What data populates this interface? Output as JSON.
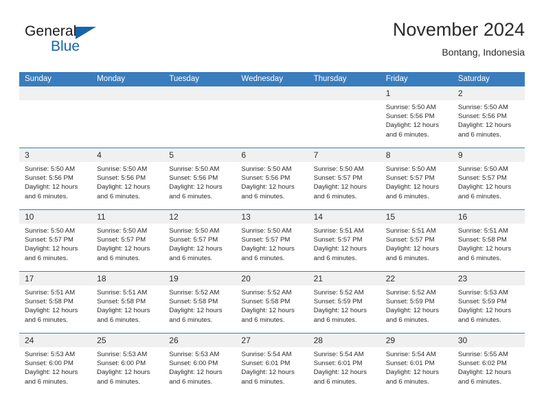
{
  "brand": {
    "name_part1": "General",
    "name_part2": "Blue",
    "triangle_color": "#1565a8"
  },
  "header": {
    "title": "November 2024",
    "subtitle": "Bontang, Indonesia"
  },
  "theme": {
    "header_blue": "#3a7dbe",
    "daynum_gray": "#f0f0f0",
    "text": "#2b2b2b"
  },
  "weekdays": [
    "Sunday",
    "Monday",
    "Tuesday",
    "Wednesday",
    "Thursday",
    "Friday",
    "Saturday"
  ],
  "labels": {
    "sunrise_prefix": "Sunrise:",
    "sunset_prefix": "Sunset:",
    "daylight_prefix": "Daylight:"
  },
  "weeks": [
    [
      {
        "day": "",
        "blank": true
      },
      {
        "day": "",
        "blank": true
      },
      {
        "day": "",
        "blank": true
      },
      {
        "day": "",
        "blank": true
      },
      {
        "day": "",
        "blank": true
      },
      {
        "day": "1",
        "sunrise": "Sunrise: 5:50 AM",
        "sunset": "Sunset: 5:56 PM",
        "daylight1": "Daylight: 12 hours",
        "daylight2": "and 6 minutes."
      },
      {
        "day": "2",
        "sunrise": "Sunrise: 5:50 AM",
        "sunset": "Sunset: 5:56 PM",
        "daylight1": "Daylight: 12 hours",
        "daylight2": "and 6 minutes."
      }
    ],
    [
      {
        "day": "3",
        "sunrise": "Sunrise: 5:50 AM",
        "sunset": "Sunset: 5:56 PM",
        "daylight1": "Daylight: 12 hours",
        "daylight2": "and 6 minutes."
      },
      {
        "day": "4",
        "sunrise": "Sunrise: 5:50 AM",
        "sunset": "Sunset: 5:56 PM",
        "daylight1": "Daylight: 12 hours",
        "daylight2": "and 6 minutes."
      },
      {
        "day": "5",
        "sunrise": "Sunrise: 5:50 AM",
        "sunset": "Sunset: 5:56 PM",
        "daylight1": "Daylight: 12 hours",
        "daylight2": "and 6 minutes."
      },
      {
        "day": "6",
        "sunrise": "Sunrise: 5:50 AM",
        "sunset": "Sunset: 5:56 PM",
        "daylight1": "Daylight: 12 hours",
        "daylight2": "and 6 minutes."
      },
      {
        "day": "7",
        "sunrise": "Sunrise: 5:50 AM",
        "sunset": "Sunset: 5:57 PM",
        "daylight1": "Daylight: 12 hours",
        "daylight2": "and 6 minutes."
      },
      {
        "day": "8",
        "sunrise": "Sunrise: 5:50 AM",
        "sunset": "Sunset: 5:57 PM",
        "daylight1": "Daylight: 12 hours",
        "daylight2": "and 6 minutes."
      },
      {
        "day": "9",
        "sunrise": "Sunrise: 5:50 AM",
        "sunset": "Sunset: 5:57 PM",
        "daylight1": "Daylight: 12 hours",
        "daylight2": "and 6 minutes."
      }
    ],
    [
      {
        "day": "10",
        "sunrise": "Sunrise: 5:50 AM",
        "sunset": "Sunset: 5:57 PM",
        "daylight1": "Daylight: 12 hours",
        "daylight2": "and 6 minutes."
      },
      {
        "day": "11",
        "sunrise": "Sunrise: 5:50 AM",
        "sunset": "Sunset: 5:57 PM",
        "daylight1": "Daylight: 12 hours",
        "daylight2": "and 6 minutes."
      },
      {
        "day": "12",
        "sunrise": "Sunrise: 5:50 AM",
        "sunset": "Sunset: 5:57 PM",
        "daylight1": "Daylight: 12 hours",
        "daylight2": "and 6 minutes."
      },
      {
        "day": "13",
        "sunrise": "Sunrise: 5:50 AM",
        "sunset": "Sunset: 5:57 PM",
        "daylight1": "Daylight: 12 hours",
        "daylight2": "and 6 minutes."
      },
      {
        "day": "14",
        "sunrise": "Sunrise: 5:51 AM",
        "sunset": "Sunset: 5:57 PM",
        "daylight1": "Daylight: 12 hours",
        "daylight2": "and 6 minutes."
      },
      {
        "day": "15",
        "sunrise": "Sunrise: 5:51 AM",
        "sunset": "Sunset: 5:57 PM",
        "daylight1": "Daylight: 12 hours",
        "daylight2": "and 6 minutes."
      },
      {
        "day": "16",
        "sunrise": "Sunrise: 5:51 AM",
        "sunset": "Sunset: 5:58 PM",
        "daylight1": "Daylight: 12 hours",
        "daylight2": "and 6 minutes."
      }
    ],
    [
      {
        "day": "17",
        "sunrise": "Sunrise: 5:51 AM",
        "sunset": "Sunset: 5:58 PM",
        "daylight1": "Daylight: 12 hours",
        "daylight2": "and 6 minutes."
      },
      {
        "day": "18",
        "sunrise": "Sunrise: 5:51 AM",
        "sunset": "Sunset: 5:58 PM",
        "daylight1": "Daylight: 12 hours",
        "daylight2": "and 6 minutes."
      },
      {
        "day": "19",
        "sunrise": "Sunrise: 5:52 AM",
        "sunset": "Sunset: 5:58 PM",
        "daylight1": "Daylight: 12 hours",
        "daylight2": "and 6 minutes."
      },
      {
        "day": "20",
        "sunrise": "Sunrise: 5:52 AM",
        "sunset": "Sunset: 5:58 PM",
        "daylight1": "Daylight: 12 hours",
        "daylight2": "and 6 minutes."
      },
      {
        "day": "21",
        "sunrise": "Sunrise: 5:52 AM",
        "sunset": "Sunset: 5:59 PM",
        "daylight1": "Daylight: 12 hours",
        "daylight2": "and 6 minutes."
      },
      {
        "day": "22",
        "sunrise": "Sunrise: 5:52 AM",
        "sunset": "Sunset: 5:59 PM",
        "daylight1": "Daylight: 12 hours",
        "daylight2": "and 6 minutes."
      },
      {
        "day": "23",
        "sunrise": "Sunrise: 5:53 AM",
        "sunset": "Sunset: 5:59 PM",
        "daylight1": "Daylight: 12 hours",
        "daylight2": "and 6 minutes."
      }
    ],
    [
      {
        "day": "24",
        "sunrise": "Sunrise: 5:53 AM",
        "sunset": "Sunset: 6:00 PM",
        "daylight1": "Daylight: 12 hours",
        "daylight2": "and 6 minutes."
      },
      {
        "day": "25",
        "sunrise": "Sunrise: 5:53 AM",
        "sunset": "Sunset: 6:00 PM",
        "daylight1": "Daylight: 12 hours",
        "daylight2": "and 6 minutes."
      },
      {
        "day": "26",
        "sunrise": "Sunrise: 5:53 AM",
        "sunset": "Sunset: 6:00 PM",
        "daylight1": "Daylight: 12 hours",
        "daylight2": "and 6 minutes."
      },
      {
        "day": "27",
        "sunrise": "Sunrise: 5:54 AM",
        "sunset": "Sunset: 6:01 PM",
        "daylight1": "Daylight: 12 hours",
        "daylight2": "and 6 minutes."
      },
      {
        "day": "28",
        "sunrise": "Sunrise: 5:54 AM",
        "sunset": "Sunset: 6:01 PM",
        "daylight1": "Daylight: 12 hours",
        "daylight2": "and 6 minutes."
      },
      {
        "day": "29",
        "sunrise": "Sunrise: 5:54 AM",
        "sunset": "Sunset: 6:01 PM",
        "daylight1": "Daylight: 12 hours",
        "daylight2": "and 6 minutes."
      },
      {
        "day": "30",
        "sunrise": "Sunrise: 5:55 AM",
        "sunset": "Sunset: 6:02 PM",
        "daylight1": "Daylight: 12 hours",
        "daylight2": "and 6 minutes."
      }
    ]
  ]
}
